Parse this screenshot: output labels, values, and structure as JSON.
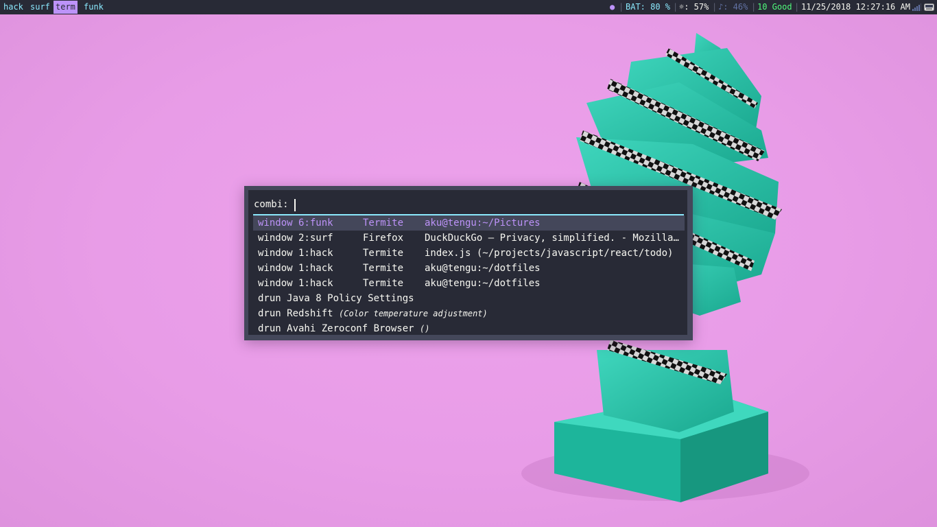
{
  "workspaces": [
    {
      "label": "hack",
      "active": false
    },
    {
      "label": "surf",
      "active": false
    },
    {
      "label": "term",
      "active": true
    },
    {
      "label": "funk",
      "active": false
    }
  ],
  "status": {
    "dot": "●",
    "battery": "BAT: 80 %",
    "brightness": "☼: 57%",
    "volume": "♪: 46%",
    "wifi": "10 Good",
    "datetime": "11/25/2018 12:27:16 AM",
    "colors": {
      "dot": "#bd93f9",
      "battery": "#8be9fd",
      "brightness": "#f8f8f2",
      "volume": "#6272a4",
      "wifi": "#50fa7b",
      "datetime": "#f8f8f2"
    }
  },
  "rofi": {
    "prompt": "combi:",
    "items": [
      {
        "col1": "window 6:funk",
        "col2": "Termite",
        "col3": "aku@tengu:~/Pictures",
        "selected": true
      },
      {
        "col1": "window 2:surf",
        "col2": "Firefox",
        "col3": "DuckDuckGo — Privacy, simplified. - Mozilla Firefox",
        "selected": false
      },
      {
        "col1": "window 1:hack",
        "col2": "Termite",
        "col3": "index.js (~/projects/javascript/react/todo)",
        "selected": false
      },
      {
        "col1": "window 1:hack",
        "col2": "Termite",
        "col3": "aku@tengu:~/dotfiles",
        "selected": false
      },
      {
        "col1": "window 1:hack",
        "col2": "Termite",
        "col3": "aku@tengu:~/dotfiles",
        "selected": false
      }
    ],
    "drun": [
      {
        "name": "drun Java 8 Policy Settings",
        "desc": ""
      },
      {
        "name": "drun Redshift",
        "desc": "(Color temperature adjustment)"
      },
      {
        "name": "drun Avahi Zeroconf Browser",
        "desc": "()"
      }
    ]
  }
}
